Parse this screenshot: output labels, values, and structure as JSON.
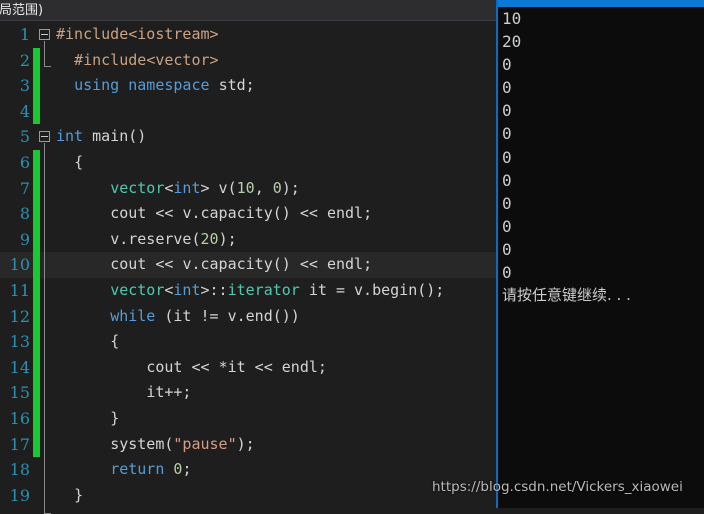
{
  "window": {
    "scope_bar_text": "全局范围)"
  },
  "editor": {
    "language": "cpp",
    "current_line": 10,
    "change_bar_color": "#1bc832",
    "background_color": "#1e1e1e",
    "lines": [
      {
        "number": "1",
        "changed": false,
        "fold": true,
        "current": false,
        "tokens": [
          {
            "text": "#include",
            "cls": "pp"
          },
          {
            "text": "<iostream>",
            "cls": "pp"
          }
        ]
      },
      {
        "number": "2",
        "changed": true,
        "fold": false,
        "current": false,
        "tokens": [
          {
            "text": "  ",
            "cls": "pl"
          },
          {
            "text": "#include",
            "cls": "pp"
          },
          {
            "text": "<vector>",
            "cls": "pp"
          }
        ]
      },
      {
        "number": "3",
        "changed": true,
        "fold": false,
        "current": false,
        "tokens": [
          {
            "text": "  ",
            "cls": "pl"
          },
          {
            "text": "using",
            "cls": "k"
          },
          {
            "text": " ",
            "cls": "pl"
          },
          {
            "text": "namespace",
            "cls": "k"
          },
          {
            "text": " ",
            "cls": "pl"
          },
          {
            "text": "std",
            "cls": "pl"
          },
          {
            "text": ";",
            "cls": "pn"
          }
        ]
      },
      {
        "number": "4",
        "changed": true,
        "fold": false,
        "current": false,
        "tokens": []
      },
      {
        "number": "5",
        "changed": false,
        "fold": true,
        "current": false,
        "tokens": [
          {
            "text": "int",
            "cls": "k"
          },
          {
            "text": " ",
            "cls": "pl"
          },
          {
            "text": "main",
            "cls": "pl"
          },
          {
            "text": "()",
            "cls": "pn"
          }
        ]
      },
      {
        "number": "6",
        "changed": true,
        "fold": false,
        "current": false,
        "tokens": [
          {
            "text": "  ",
            "cls": "pl"
          },
          {
            "text": "{",
            "cls": "pn"
          }
        ]
      },
      {
        "number": "7",
        "changed": true,
        "fold": false,
        "current": false,
        "tokens": [
          {
            "text": "      ",
            "cls": "pl"
          },
          {
            "text": "vector",
            "cls": "t"
          },
          {
            "text": "<",
            "cls": "pn"
          },
          {
            "text": "int",
            "cls": "k"
          },
          {
            "text": ">",
            "cls": "pn"
          },
          {
            "text": " v",
            "cls": "pl"
          },
          {
            "text": "(",
            "cls": "pn"
          },
          {
            "text": "10",
            "cls": "num"
          },
          {
            "text": ", ",
            "cls": "pn"
          },
          {
            "text": "0",
            "cls": "num"
          },
          {
            "text": ");",
            "cls": "pn"
          }
        ]
      },
      {
        "number": "8",
        "changed": true,
        "fold": false,
        "current": false,
        "tokens": [
          {
            "text": "      ",
            "cls": "pl"
          },
          {
            "text": "cout",
            "cls": "pl"
          },
          {
            "text": " << ",
            "cls": "pn"
          },
          {
            "text": "v.capacity",
            "cls": "pl"
          },
          {
            "text": "()",
            "cls": "pn"
          },
          {
            "text": " << ",
            "cls": "pn"
          },
          {
            "text": "endl",
            "cls": "pl"
          },
          {
            "text": ";",
            "cls": "pn"
          }
        ]
      },
      {
        "number": "9",
        "changed": true,
        "fold": false,
        "current": false,
        "tokens": [
          {
            "text": "      ",
            "cls": "pl"
          },
          {
            "text": "v.reserve",
            "cls": "pl"
          },
          {
            "text": "(",
            "cls": "pn"
          },
          {
            "text": "20",
            "cls": "num"
          },
          {
            "text": ");",
            "cls": "pn"
          }
        ]
      },
      {
        "number": "10",
        "changed": true,
        "fold": false,
        "current": true,
        "tokens": [
          {
            "text": "      ",
            "cls": "pl"
          },
          {
            "text": "cout",
            "cls": "pl"
          },
          {
            "text": " << ",
            "cls": "pn"
          },
          {
            "text": "v.capacity",
            "cls": "pl"
          },
          {
            "text": "()",
            "cls": "pn"
          },
          {
            "text": " << ",
            "cls": "pn"
          },
          {
            "text": "endl",
            "cls": "pl"
          },
          {
            "text": ";",
            "cls": "pn"
          }
        ]
      },
      {
        "number": "11",
        "changed": true,
        "fold": false,
        "current": false,
        "tokens": [
          {
            "text": "      ",
            "cls": "pl"
          },
          {
            "text": "vector",
            "cls": "t"
          },
          {
            "text": "<",
            "cls": "pn"
          },
          {
            "text": "int",
            "cls": "k"
          },
          {
            "text": ">",
            "cls": "pn"
          },
          {
            "text": "::",
            "cls": "pn"
          },
          {
            "text": "iterator",
            "cls": "t"
          },
          {
            "text": " it ",
            "cls": "pl"
          },
          {
            "text": "= ",
            "cls": "pn"
          },
          {
            "text": "v.begin",
            "cls": "pl"
          },
          {
            "text": "();",
            "cls": "pn"
          }
        ]
      },
      {
        "number": "12",
        "changed": true,
        "fold": false,
        "current": false,
        "tokens": [
          {
            "text": "      ",
            "cls": "pl"
          },
          {
            "text": "while",
            "cls": "k"
          },
          {
            "text": " ",
            "cls": "pl"
          },
          {
            "text": "(",
            "cls": "pn"
          },
          {
            "text": "it ",
            "cls": "pl"
          },
          {
            "text": "!= ",
            "cls": "pn"
          },
          {
            "text": "v.end",
            "cls": "pl"
          },
          {
            "text": "())",
            "cls": "pn"
          }
        ]
      },
      {
        "number": "13",
        "changed": true,
        "fold": false,
        "current": false,
        "tokens": [
          {
            "text": "      ",
            "cls": "pl"
          },
          {
            "text": "{",
            "cls": "pn"
          }
        ]
      },
      {
        "number": "14",
        "changed": true,
        "fold": false,
        "current": false,
        "tokens": [
          {
            "text": "          ",
            "cls": "pl"
          },
          {
            "text": "cout",
            "cls": "pl"
          },
          {
            "text": " << ",
            "cls": "pn"
          },
          {
            "text": "*",
            "cls": "pn"
          },
          {
            "text": "it",
            "cls": "pl"
          },
          {
            "text": " << ",
            "cls": "pn"
          },
          {
            "text": "endl",
            "cls": "pl"
          },
          {
            "text": ";",
            "cls": "pn"
          }
        ]
      },
      {
        "number": "15",
        "changed": true,
        "fold": false,
        "current": false,
        "tokens": [
          {
            "text": "          ",
            "cls": "pl"
          },
          {
            "text": "it",
            "cls": "pl"
          },
          {
            "text": "++;",
            "cls": "pn"
          }
        ]
      },
      {
        "number": "16",
        "changed": true,
        "fold": false,
        "current": false,
        "tokens": [
          {
            "text": "      ",
            "cls": "pl"
          },
          {
            "text": "}",
            "cls": "pn"
          }
        ]
      },
      {
        "number": "17",
        "changed": true,
        "fold": false,
        "current": false,
        "tokens": [
          {
            "text": "      ",
            "cls": "pl"
          },
          {
            "text": "system",
            "cls": "pl"
          },
          {
            "text": "(",
            "cls": "pn"
          },
          {
            "text": "\"pause\"",
            "cls": "str"
          },
          {
            "text": ");",
            "cls": "pn"
          }
        ]
      },
      {
        "number": "18",
        "changed": false,
        "fold": false,
        "current": false,
        "tokens": [
          {
            "text": "      ",
            "cls": "pl"
          },
          {
            "text": "return",
            "cls": "k"
          },
          {
            "text": " ",
            "cls": "pl"
          },
          {
            "text": "0",
            "cls": "num"
          },
          {
            "text": ";",
            "cls": "pn"
          }
        ]
      },
      {
        "number": "19",
        "changed": false,
        "fold": false,
        "current": false,
        "tokens": [
          {
            "text": "  ",
            "cls": "pl"
          },
          {
            "text": "}",
            "cls": "pn"
          }
        ]
      }
    ]
  },
  "console": {
    "title_bar_color": "#0a7ad6",
    "background_color": "#0c0c0c",
    "text_color": "#cccccc",
    "lines": [
      {
        "text": "10",
        "cjk": false
      },
      {
        "text": "20",
        "cjk": false
      },
      {
        "text": "0",
        "cjk": false
      },
      {
        "text": "0",
        "cjk": false
      },
      {
        "text": "0",
        "cjk": false
      },
      {
        "text": "0",
        "cjk": false
      },
      {
        "text": "0",
        "cjk": false
      },
      {
        "text": "0",
        "cjk": false
      },
      {
        "text": "0",
        "cjk": false
      },
      {
        "text": "0",
        "cjk": false
      },
      {
        "text": "0",
        "cjk": false
      },
      {
        "text": "0",
        "cjk": false
      },
      {
        "text": "请按任意键继续. . .",
        "cjk": true
      }
    ]
  },
  "watermark": {
    "text": "https://blog.csdn.net/Vickers_xiaowei"
  }
}
